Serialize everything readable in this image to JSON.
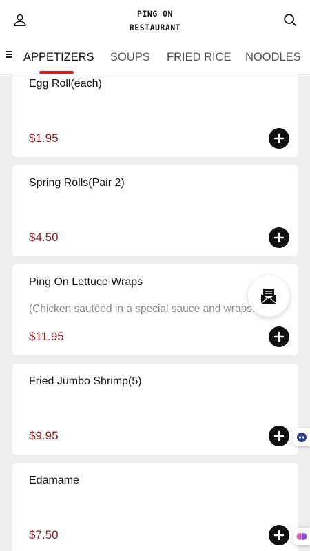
{
  "header": {
    "title_line1": "PING ON",
    "title_line2": "RESTAURANT",
    "left_icon": "user-icon",
    "right_icon": "search-icon"
  },
  "tabs": {
    "menu_icon": "hamburger-menu-icon",
    "items": [
      {
        "label": "APPETIZERS",
        "active": true
      },
      {
        "label": "SOUPS",
        "active": false
      },
      {
        "label": "FRIED RICE",
        "active": false
      },
      {
        "label": "NOODLES",
        "active": false
      }
    ],
    "accent_color": "#e01a1a"
  },
  "menu_items": [
    {
      "name": "Egg Roll(each)",
      "description": "",
      "price": "$1.95"
    },
    {
      "name": "Spring Rolls(Pair 2)",
      "description": "",
      "price": "$4.50"
    },
    {
      "name": "Ping On Lettuce Wraps",
      "description": "(Chicken sautéed in a special sauce and wraps...",
      "price": "$11.95"
    },
    {
      "name": "Fried Jumbo Shrimp(5)",
      "description": "",
      "price": "$9.95"
    },
    {
      "name": "Edamame",
      "description": "",
      "price": "$7.50"
    }
  ],
  "colors": {
    "price": "#8b1a1a",
    "add_button": "#111111",
    "background": "#eeeeee"
  },
  "floating": {
    "contact_icon": "envelope-open-icon",
    "side_widgets": [
      "assistant-face-icon",
      "brain-icon"
    ]
  }
}
